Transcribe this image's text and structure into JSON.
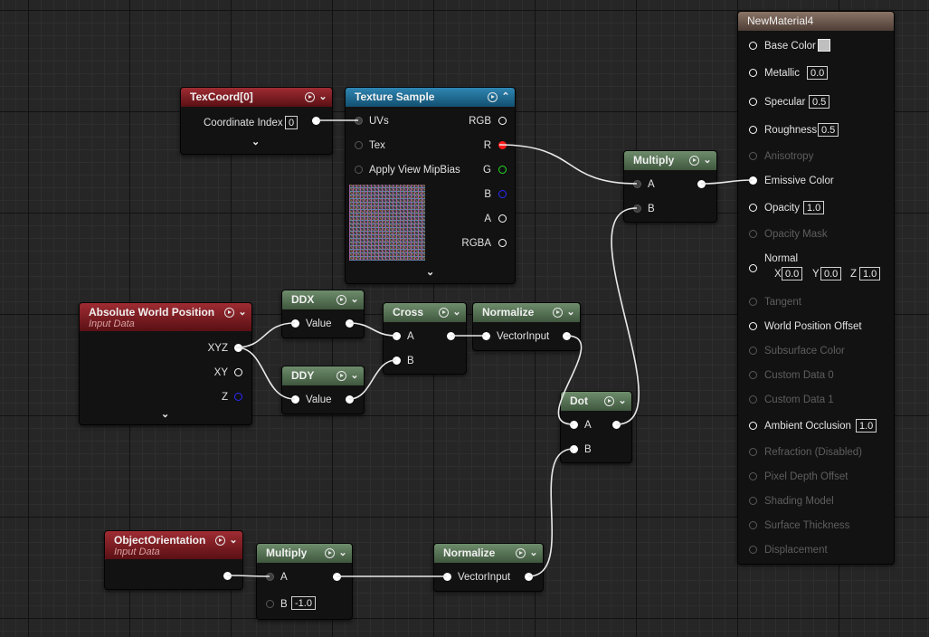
{
  "nodes": {
    "texcoord": {
      "title": "TexCoord[0]",
      "coordinate_index_label": "Coordinate Index",
      "coordinate_index_value": "0"
    },
    "texture_sample": {
      "title": "Texture Sample",
      "inputs": [
        "UVs",
        "Tex",
        "Apply View MipBias"
      ],
      "outputs": [
        "RGB",
        "R",
        "G",
        "B",
        "A",
        "RGBA"
      ]
    },
    "multiply_top": {
      "title": "Multiply",
      "inputs": [
        "A",
        "B"
      ]
    },
    "absolute_world_position": {
      "title": "Absolute World Position",
      "subtitle": "Input Data",
      "outputs": [
        "XYZ",
        "XY",
        "Z"
      ]
    },
    "ddx": {
      "title": "DDX",
      "input": "Value"
    },
    "ddy": {
      "title": "DDY",
      "input": "Value"
    },
    "cross": {
      "title": "Cross",
      "inputs": [
        "A",
        "B"
      ]
    },
    "normalize_top": {
      "title": "Normalize",
      "input": "VectorInput"
    },
    "dot": {
      "title": "Dot",
      "inputs": [
        "A",
        "B"
      ]
    },
    "object_orientation": {
      "title": "ObjectOrientation",
      "subtitle": "Input Data"
    },
    "multiply_bottom": {
      "title": "Multiply",
      "inputs": [
        "A",
        "B"
      ],
      "b_value": "-1.0"
    },
    "normalize_bottom": {
      "title": "Normalize",
      "input": "VectorInput"
    }
  },
  "material": {
    "title": "NewMaterial4",
    "base_color": "Base Color",
    "base_color_swatch": "#bfbfbf",
    "metallic": {
      "label": "Metallic",
      "value": "0.0"
    },
    "specular": {
      "label": "Specular",
      "value": "0.5"
    },
    "roughness": {
      "label": "Roughness",
      "value": "0.5"
    },
    "anisotropy": "Anisotropy",
    "emissive_color": "Emissive Color",
    "opacity": {
      "label": "Opacity",
      "value": "1.0"
    },
    "opacity_mask": "Opacity Mask",
    "normal": {
      "label": "Normal",
      "x_label": "X",
      "x": "0.0",
      "y_label": "Y",
      "y": "0.0",
      "z_label": "Z",
      "z": "1.0"
    },
    "tangent": "Tangent",
    "world_position_offset": "World Position Offset",
    "subsurface_color": "Subsurface Color",
    "custom_data_0": "Custom Data 0",
    "custom_data_1": "Custom Data 1",
    "ambient_occlusion": {
      "label": "Ambient Occlusion",
      "value": "1.0"
    },
    "refraction": "Refraction (Disabled)",
    "pixel_depth_offset": "Pixel Depth Offset",
    "shading_model": "Shading Model",
    "surface_thickness": "Surface Thickness",
    "displacement": "Displacement"
  },
  "colors": {
    "background": "#262626",
    "input_header_red": "#9e2c33",
    "texture_header_blue": "#2e86b3",
    "math_header_green": "#6e8d6c",
    "result_header_brown": "#8a7466",
    "wire": "#e8e8e8",
    "pin_r": "#ff1a1a",
    "pin_g": "#22dd22",
    "pin_b": "#2a2aff"
  },
  "icons": {
    "preview_toggle": "play-circle-icon",
    "collapse": "chevron-down-icon",
    "expand": "chevron-up-icon"
  }
}
